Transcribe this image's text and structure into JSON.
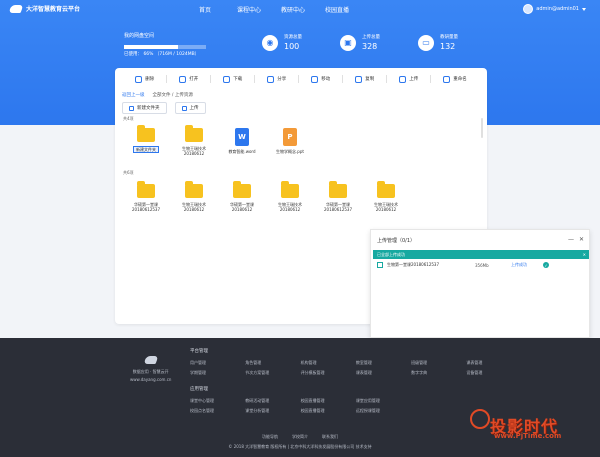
{
  "header": {
    "brand": "大洋智慧教育云平台",
    "nav": [
      "首页",
      "课程中心",
      "教研中心",
      "校园直播"
    ],
    "user": "admin@admin01"
  },
  "storage": {
    "title": "我的网盘空间",
    "used_label": "已使用",
    "percent": "66%",
    "detail": "716M / 1024MB",
    "fill_fraction": 0.66
  },
  "stats": [
    {
      "label": "资源总量",
      "value": "100",
      "icon": "film-reel-icon"
    },
    {
      "label": "上传总量",
      "value": "328",
      "icon": "camera-icon"
    },
    {
      "label": "教研量量",
      "value": "132",
      "icon": "monitor-icon"
    }
  ],
  "toolbar": [
    "删除",
    "打开",
    "下载",
    "分享",
    "移动",
    "复制",
    "上传",
    "重命名"
  ],
  "crumb": {
    "back": "返回上一级",
    "path": "全部文件 / 上传资源"
  },
  "actions": {
    "new_folder": "新建文件夹",
    "upload": "上传"
  },
  "sections": [
    "共4项",
    "共6项"
  ],
  "row1": [
    {
      "name": "新建文件夹",
      "type": "folder",
      "selected": true
    },
    {
      "name": "生物王瑞技术\n20180612",
      "type": "folder"
    },
    {
      "name": "教育智能.word",
      "type": "word"
    },
    {
      "name": "生物学概念.ppt",
      "type": "ppt"
    }
  ],
  "row2": [
    {
      "name": "华硕第一堂课\n20180612537",
      "type": "folder"
    },
    {
      "name": "生物王瑞技术\n20180612",
      "type": "folder"
    },
    {
      "name": "华硕第一堂课\n20180612",
      "type": "folder"
    },
    {
      "name": "生物王瑞技术\n20180612",
      "type": "folder"
    },
    {
      "name": "华硕第一堂课\n20180612537",
      "type": "folder"
    },
    {
      "name": "生物王瑞技术\n20180612",
      "type": "folder"
    }
  ],
  "dialog": {
    "title": "上传管理（0/1）",
    "status": "已全部上传成功",
    "file": "生物第一堂课20180612537",
    "size": "356Mb",
    "state": "上传成功"
  },
  "footer": {
    "brand_line1": "数据应用 · 智慧云开",
    "brand_line2": "www.dayang.com.cn",
    "group1_title": "平台管理",
    "group1": [
      [
        "用户管理",
        "角色管理",
        "机构管理",
        "教室管理",
        "班级管理",
        "课表管理"
      ],
      [
        "学期管理",
        "节次方案管理",
        "评分模板管理",
        "课表管理",
        "数字字典",
        "设备管理"
      ]
    ],
    "group2_title": "应用管理",
    "group2": [
      [
        "课堂中心管理",
        "教研活动管理",
        "校园直播管理",
        "课堂应用管理"
      ],
      [
        "校园点名管理",
        "课堂分析管理",
        "校园直播管理",
        "远程授课管理"
      ]
    ],
    "bottom_links": [
      "功能导航",
      "学校简介",
      "联系我们"
    ],
    "copyright": "© 2018 大洋智慧教育 版权所有 | 北京中科大洋科技发展股份有限公司 技术支持"
  },
  "watermark": {
    "title": "投影时代",
    "sub": "www.PjTime.com"
  }
}
